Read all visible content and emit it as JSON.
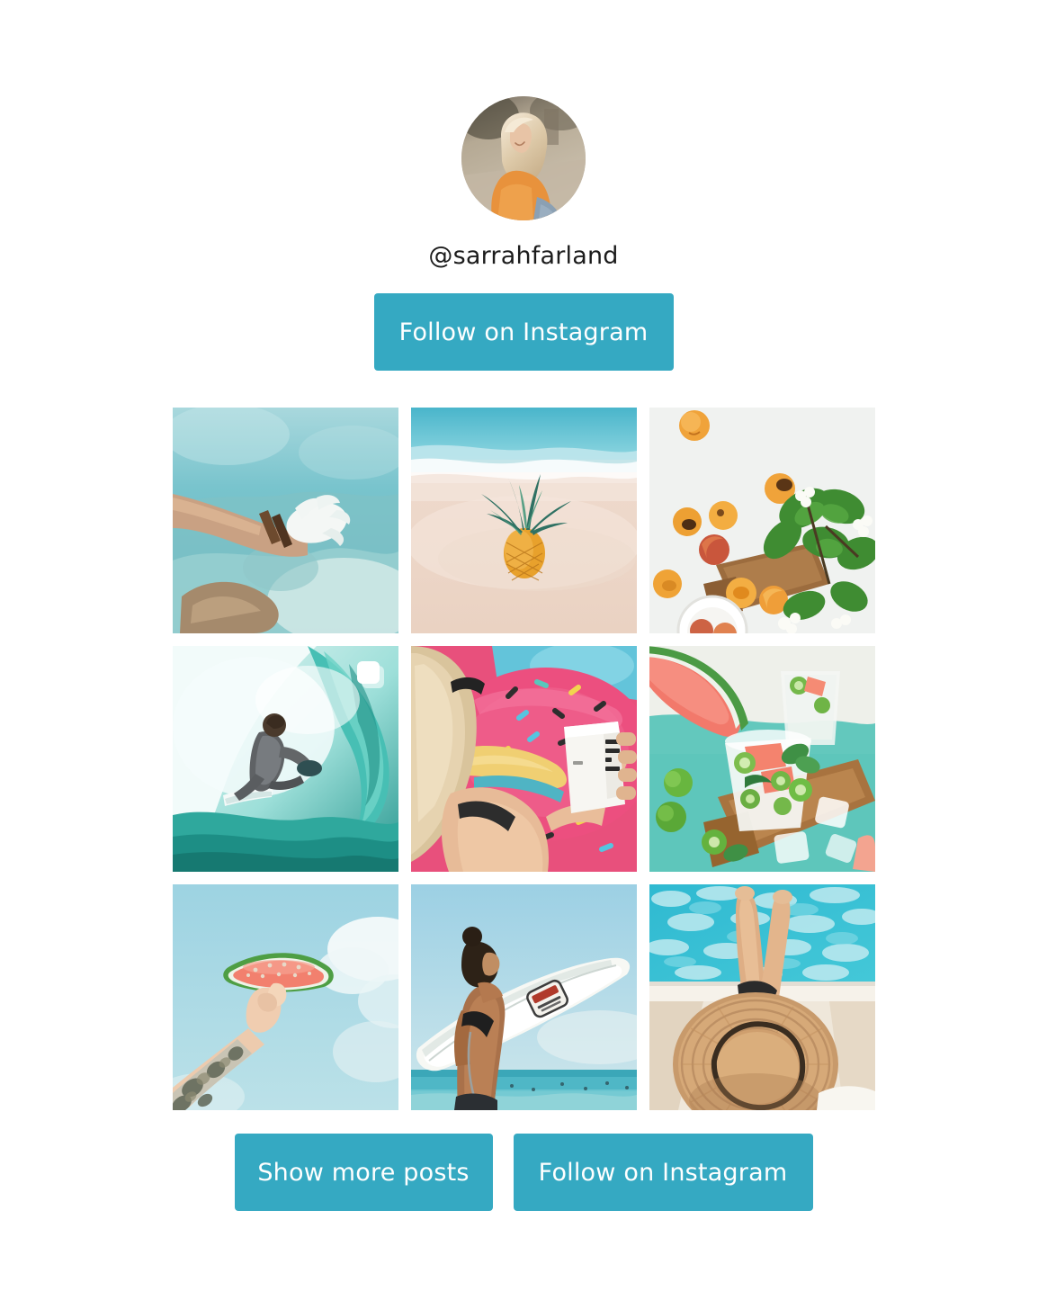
{
  "widget": {
    "type": "instagram-feed-widget",
    "background_color": "#ffffff",
    "accent_color": "#35a9c2"
  },
  "header": {
    "avatar_alt": "profile-photo-blonde-woman-orange-top",
    "username": "@sarrahfarland",
    "follow_button_label": "Follow on Instagram"
  },
  "grid": {
    "columns": 3,
    "rows": 3,
    "posts": [
      {
        "index": 1,
        "alt": "underwater-hand-reaching-coral",
        "is_carousel": false,
        "palette": [
          "#7fc6d0",
          "#a9ddde",
          "#c9b79c",
          "#e6f1f0"
        ]
      },
      {
        "index": 2,
        "alt": "pineapple-on-beach-shoreline",
        "is_carousel": false,
        "palette": [
          "#6fc2d4",
          "#bfe6ea",
          "#f0ddd0",
          "#e9a52f"
        ]
      },
      {
        "index": 3,
        "alt": "apricots-flatlay-cutting-board-greenery",
        "is_carousel": false,
        "palette": [
          "#f2f3f1",
          "#f0a33a",
          "#4e9c3c",
          "#9a6b3e"
        ]
      },
      {
        "index": 4,
        "alt": "surfer-riding-barrel-wave",
        "is_carousel": true,
        "palette": [
          "#e8f6f5",
          "#4fc0b7",
          "#17837c",
          "#56585a"
        ]
      },
      {
        "index": 5,
        "alt": "woman-on-pink-donut-pool-float-holding-boxed-water",
        "is_carousel": false,
        "palette": [
          "#e8527e",
          "#e8cfa8",
          "#7fd4e0",
          "#f4f2ec"
        ]
      },
      {
        "index": 6,
        "alt": "watermelon-cocktail-with-limes-on-board",
        "is_carousel": false,
        "palette": [
          "#f2796b",
          "#5fc9bd",
          "#f3f4ef",
          "#a8733f"
        ]
      },
      {
        "index": 7,
        "alt": "tattooed-arm-holding-watermelon-slice-against-sky",
        "is_carousel": false,
        "palette": [
          "#a9d9e4",
          "#f2836e",
          "#8cc05e",
          "#eed5c0"
        ]
      },
      {
        "index": 8,
        "alt": "man-carrying-white-surfboard-at-beach",
        "is_carousel": false,
        "palette": [
          "#a9d3e4",
          "#f4f3ef",
          "#7b563c",
          "#4fb5c3"
        ]
      },
      {
        "index": 9,
        "alt": "straw-hat-woman-legs-by-swimming-pool",
        "is_carousel": false,
        "palette": [
          "#45c3d4",
          "#c9a072",
          "#f3efe6",
          "#e0b68c"
        ]
      }
    ]
  },
  "footer": {
    "show_more_label": "Show more posts",
    "follow_button_label": "Follow on Instagram"
  }
}
